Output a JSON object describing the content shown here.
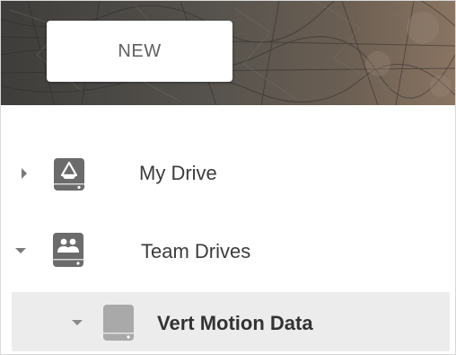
{
  "toolbar": {
    "new_label": "NEW"
  },
  "nav": {
    "items": [
      {
        "label": "My Drive",
        "icon": "my-drive-icon",
        "expanded": false
      },
      {
        "label": "Team Drives",
        "icon": "team-drives-icon",
        "expanded": true
      },
      {
        "label": "Vert Motion Data",
        "icon": "team-drive-icon",
        "expanded": true,
        "selected": true
      }
    ]
  },
  "colors": {
    "banner": "#4d4a46",
    "icon": "#6b6b6b",
    "selected_row": "#ececec",
    "text": "#3c3c3c"
  }
}
